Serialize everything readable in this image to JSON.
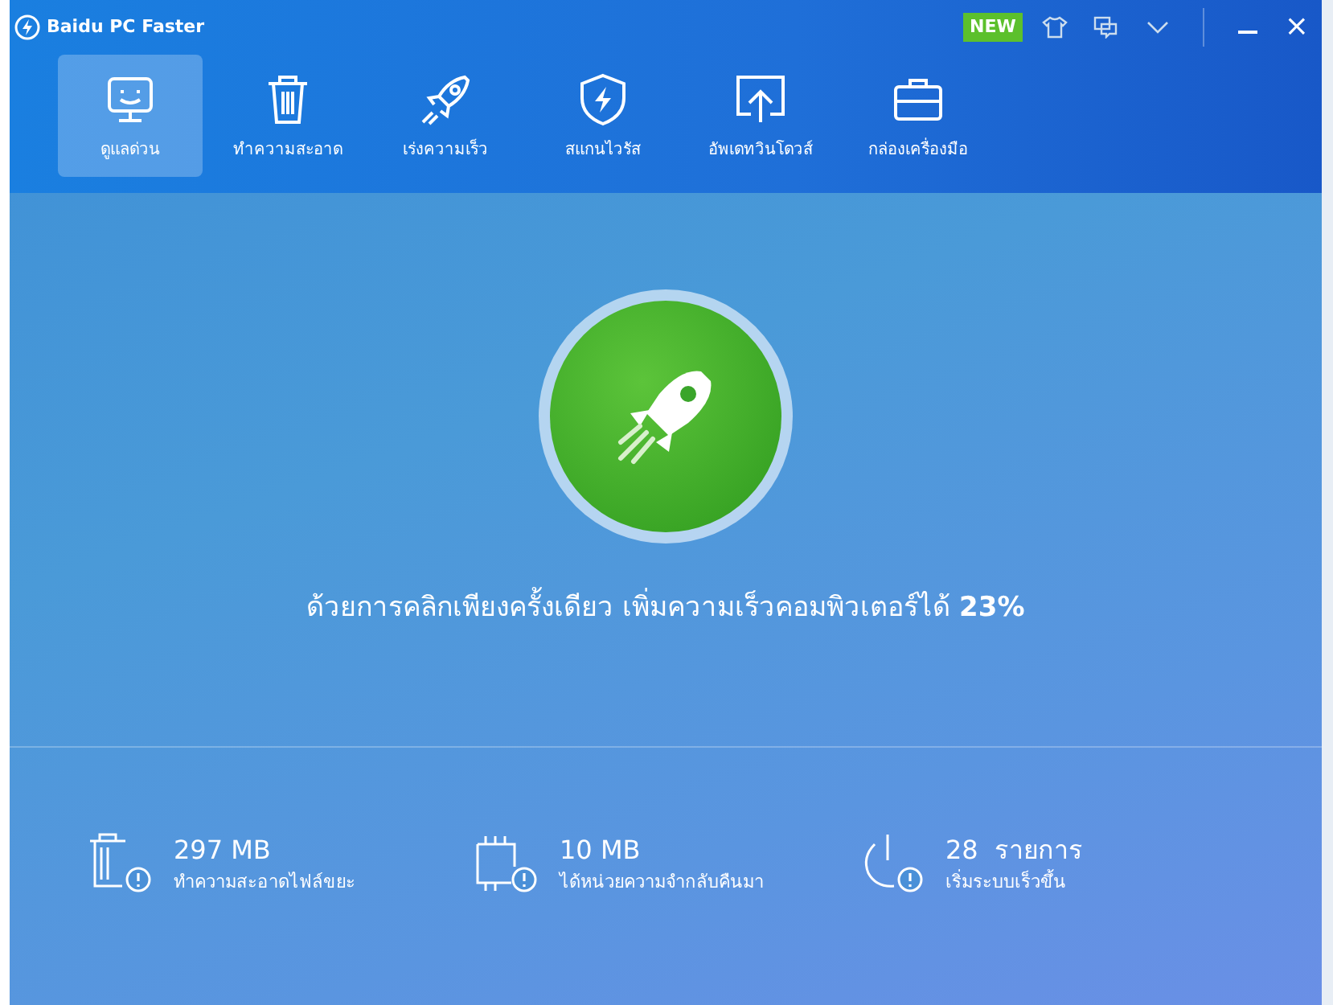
{
  "window": {
    "title": "Baidu PC Faster",
    "new_badge": "NEW",
    "close": "×"
  },
  "tabs": [
    {
      "label": "ดูแลด่วน",
      "selected": true,
      "kind": "monitor"
    },
    {
      "label": "ทำความสะอาด",
      "selected": false,
      "kind": "trash"
    },
    {
      "label": "เร่งความเร็ว",
      "selected": false,
      "kind": "rocket"
    },
    {
      "label": "สแกนไวรัส",
      "selected": false,
      "kind": "shield"
    },
    {
      "label": "อัพเดทวินโดวส์",
      "selected": false,
      "kind": "upload"
    },
    {
      "label": "กล่องเครื่องมือ",
      "selected": false,
      "kind": "toolbox"
    }
  ],
  "headline": "ด้วยการคลิกเพียงครั้งเดียว เพิ่มความเร็วคอมพิวเตอร์ได้ **23%**",
  "stats": [
    {
      "kind": "trash",
      "value": "297 MB",
      "label": "ทำความสะอาดไฟล์ขยะ"
    },
    {
      "kind": "memory",
      "value": "10 MB",
      "label": "ได้หน่วยความจำกลับคืนมา"
    },
    {
      "kind": "power",
      "value": "28  รายการ",
      "label": "เริ่มระบบเร็วขึ้น"
    }
  ]
}
